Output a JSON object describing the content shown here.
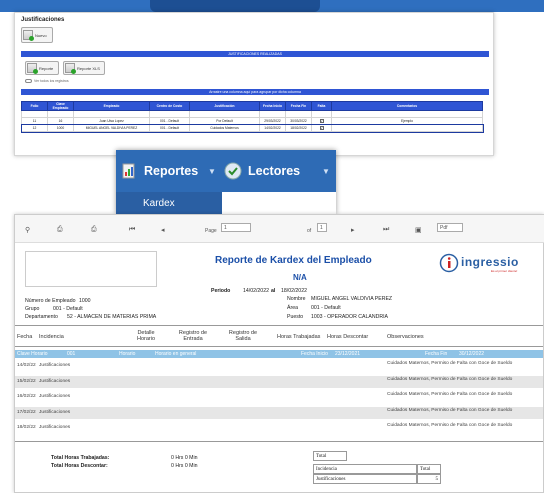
{
  "justificaciones": {
    "title": "Justificaciones",
    "new_label": "Nuevo",
    "band_title": "JUSTIFICACIONES REALIZADAS",
    "btn_report": "Reporte",
    "btn_report_xls": "Reporte XLS",
    "toggle_label": "Ver todos los registros",
    "group_hint": "Arrastre una columna aquí para agrupar por dicha columna",
    "columns": [
      "Folio",
      "Clave Empleado",
      "Empleado",
      "Centro de Costo",
      "Justificación",
      "Fecha Inicio",
      "Fecha Fin",
      "Falta",
      "Comentarios"
    ],
    "rows": [
      {
        "folio": "11",
        "clave": "16",
        "empleado": "Juan Uisa Lopez",
        "centro": "001 - Default",
        "just": "Por Default",
        "ini": "29/03/2022",
        "fin": "30/03/2022",
        "falta": "✓",
        "com": "Ejemplo"
      },
      {
        "folio": "12",
        "clave": "1000",
        "empleado": "MIGUEL ANGEL VALDIVIA PEREZ",
        "centro": "001 - Default",
        "just": "Cuidados Maternos",
        "ini": "14/02/2022",
        "fin": "18/02/2022",
        "falta": "✓",
        "com": ""
      }
    ]
  },
  "menu": {
    "reportes": "Reportes",
    "lectores": "Lectores",
    "kardex": "Kardex"
  },
  "viewer": {
    "page_label": "Page",
    "page_value": "1",
    "of_label": "of",
    "of_value": "1",
    "format_value": "Pdf"
  },
  "report": {
    "title": "Reporte de Kardex del Empleado",
    "subtitle": "N/A",
    "logo": "ingressio",
    "logo_tag": "Es el primer cliente!",
    "periodo_label": "Periodo",
    "periodo_from": "14/02/2022",
    "periodo_al": "al",
    "periodo_to": "18/02/2022",
    "emp_label": "Número de Empleado",
    "emp_value": "1000",
    "grupo_label": "Grupo",
    "grupo_value": "001 - Default",
    "depto_label": "Departamento",
    "depto_value": "52 - ALMACEN DE MATERIAS PRIMA",
    "nombre_label": "Nombre",
    "nombre_value": "MIGUEL ANGEL VALDIVIA PEREZ",
    "area_label": "Área",
    "area_value": "001 - Default",
    "puesto_label": "Puesto",
    "puesto_value": "1003 - OPERADOR CALANDRIA",
    "cols": [
      "Fecha",
      "Incidencia",
      "Detalle Horario",
      "Registro de Entrada",
      "Registro de Salida",
      "Horas Trabajadas",
      "Horas Descontar",
      "Observaciones"
    ],
    "clave_label": "Clave Horario",
    "clave_value": "001",
    "horario_label": "Horario",
    "horario_value": "Horario en general",
    "fi_label": "Fecha Inicio",
    "fi_value": "23/12/2021",
    "ff_label": "Fecha Fin",
    "ff_value": "30/12/2022",
    "rows": [
      {
        "fecha": "14/02/22",
        "inc": "Justificaciones",
        "obs": "Cuidados Maternos, Permiso de Falta con Goce de Sueldo"
      },
      {
        "fecha": "15/02/22",
        "inc": "Justificaciones",
        "obs": "Cuidados Maternos, Permiso de Falta con Goce de Sueldo"
      },
      {
        "fecha": "16/02/22",
        "inc": "Justificaciones",
        "obs": "Cuidados Maternos, Permiso de Falta con Goce de Sueldo"
      },
      {
        "fecha": "17/02/22",
        "inc": "Justificaciones",
        "obs": "Cuidados Maternos, Permiso de Falta con Goce de Sueldo"
      },
      {
        "fecha": "18/02/22",
        "inc": "Justificaciones",
        "obs": "Cuidados Maternos, Permiso de Falta con Goce de Sueldo"
      }
    ],
    "tot_trab_label": "Total Horas Trabajadas:",
    "tot_trab_value": "0 Hrs 0 Min",
    "tot_desc_label": "Total Horas Descontar:",
    "tot_desc_value": "0 Hrs 0 Min",
    "total_label": "Total",
    "inc_label": "Incidencia",
    "inc_total_label": "Total",
    "just_label": "Justificaciones",
    "just_total": "5"
  }
}
